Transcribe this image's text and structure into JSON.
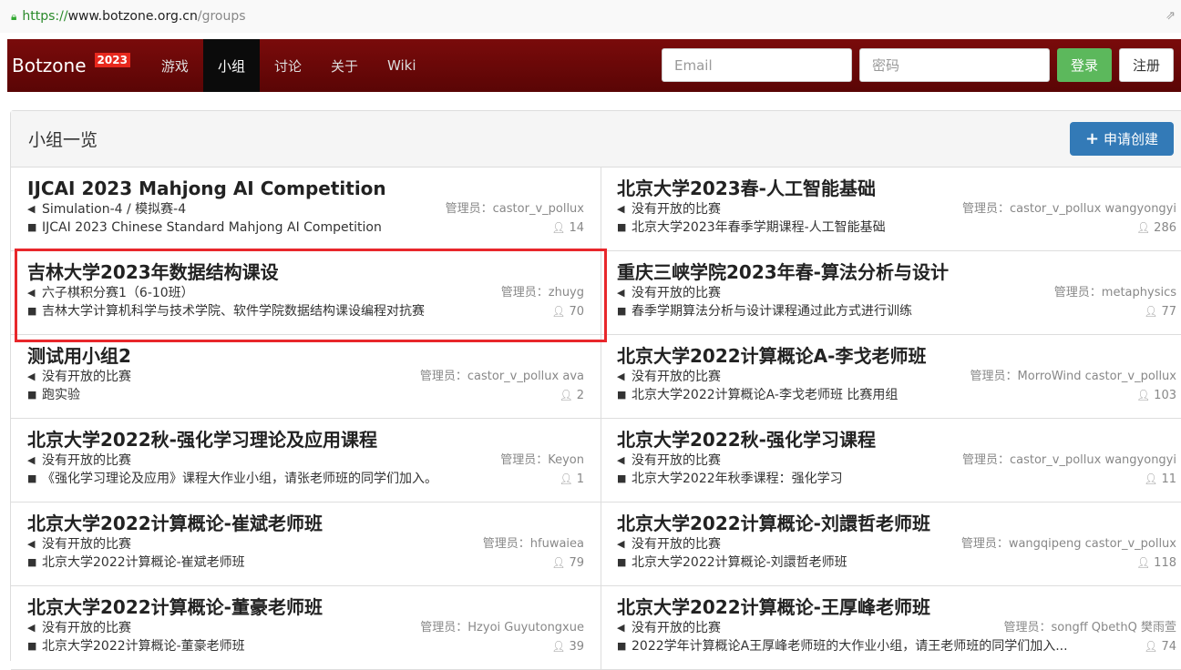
{
  "browser": {
    "url_scheme": "https://",
    "url_host": "www.botzone.org.cn",
    "url_path": "/groups"
  },
  "navbar": {
    "brand": "Botzone",
    "brand_year": "2023",
    "items": [
      {
        "label": "游戏",
        "active": false
      },
      {
        "label": "小组",
        "active": true
      },
      {
        "label": "讨论",
        "active": false
      },
      {
        "label": "关于",
        "active": false
      },
      {
        "label": "Wiki",
        "active": false
      }
    ],
    "email_placeholder": "Email",
    "password_placeholder": "密码",
    "login_label": "登录",
    "register_label": "注册"
  },
  "panel": {
    "title": "小组一览",
    "apply_label": "申请创建"
  },
  "labels": {
    "admin_prefix": "管理员："
  },
  "groups": [
    {
      "name": "IJCAI 2023 Mahjong AI Competition",
      "contest": "Simulation-4 / 模拟赛-4",
      "admins": "castor_v_pollux",
      "desc": "IJCAI 2023 Chinese Standard Mahjong AI Competition",
      "members": "14"
    },
    {
      "name": "北京大学2023春-人工智能基础",
      "contest": "没有开放的比赛",
      "admins": "castor_v_pollux wangyongyi",
      "desc": "北京大学2023年春季学期课程-人工智能基础",
      "members": "286"
    },
    {
      "name": "吉林大学2023年数据结构课设",
      "contest": "六子棋积分赛1（6-10班）",
      "admins": "zhuyg",
      "desc": "吉林大学计算机科学与技术学院、软件学院数据结构课设编程对抗赛",
      "members": "70"
    },
    {
      "name": "重庆三峡学院2023年春-算法分析与设计",
      "contest": "没有开放的比赛",
      "admins": "metaphysics",
      "desc": "春季学期算法分析与设计课程通过此方式进行训练",
      "members": "77"
    },
    {
      "name": "测试用小组2",
      "contest": "没有开放的比赛",
      "admins": "castor_v_pollux ava",
      "desc": "跑实验",
      "members": "2"
    },
    {
      "name": "北京大学2022计算概论A-李戈老师班",
      "contest": "没有开放的比赛",
      "admins": "MorroWind castor_v_pollux",
      "desc": "北京大学2022计算概论A-李戈老师班 比赛用组",
      "members": "103"
    },
    {
      "name": "北京大学2022秋-强化学习理论及应用课程",
      "contest": "没有开放的比赛",
      "admins": "Keyon",
      "desc": "《强化学习理论及应用》课程大作业小组，请张老师班的同学们加入。",
      "members": "1"
    },
    {
      "name": "北京大学2022秋-强化学习课程",
      "contest": "没有开放的比赛",
      "admins": "castor_v_pollux wangyongyi",
      "desc": "北京大学2022年秋季课程：强化学习",
      "members": "11"
    },
    {
      "name": "北京大学2022计算概论-崔斌老师班",
      "contest": "没有开放的比赛",
      "admins": "hfuwaiea",
      "desc": "北京大学2022计算概论-崔斌老师班",
      "members": "79"
    },
    {
      "name": "北京大学2022计算概论-刘譞哲老师班",
      "contest": "没有开放的比赛",
      "admins": "wangqipeng castor_v_pollux",
      "desc": "北京大学2022计算概论-刘譞哲老师班",
      "members": "118"
    },
    {
      "name": "北京大学2022计算概论-董豪老师班",
      "contest": "没有开放的比赛",
      "admins": "Hzyoi Guyutongxue",
      "desc": "北京大学2022计算概论-董豪老师班",
      "members": "39"
    },
    {
      "name": "北京大学2022计算概论-王厚峰老师班",
      "contest": "没有开放的比赛",
      "admins": "songff QbethQ 樊雨萱",
      "desc": "2022学年计算概论A王厚峰老师班的大作业小组，请王老师班的同学们加入...",
      "members": "74"
    }
  ]
}
